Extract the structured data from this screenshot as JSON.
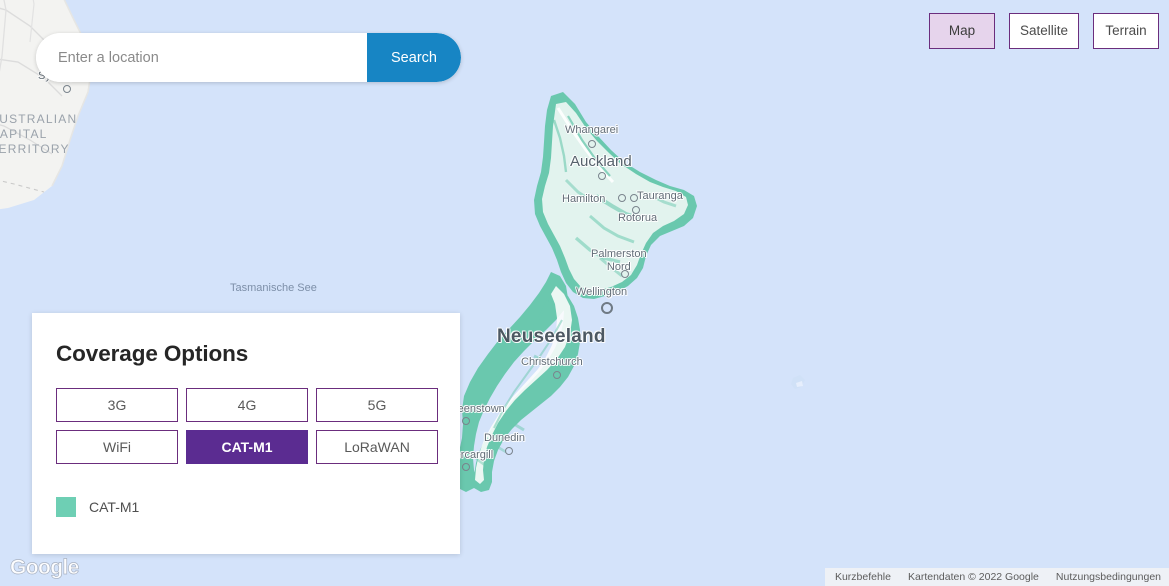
{
  "search": {
    "placeholder": "Enter a location",
    "value": "",
    "button_label": "Search"
  },
  "map_types": [
    {
      "label": "Map",
      "active": true
    },
    {
      "label": "Satellite",
      "active": false
    },
    {
      "label": "Terrain",
      "active": false
    }
  ],
  "coverage_panel": {
    "title": "Coverage Options",
    "options": [
      {
        "label": "3G",
        "selected": false
      },
      {
        "label": "4G",
        "selected": false
      },
      {
        "label": "5G",
        "selected": false
      },
      {
        "label": "WiFi",
        "selected": false
      },
      {
        "label": "CAT-M1",
        "selected": true
      },
      {
        "label": "LoRaWAN",
        "selected": false
      }
    ],
    "legend": {
      "label": "CAT-M1",
      "color": "#6ecfb4"
    }
  },
  "map": {
    "country_label": "Neuseeland",
    "sea_label": "Tasmanische See",
    "region_label": "AUSTRALIAN CAPITAL TERRITORY",
    "cities": [
      {
        "name": "Sydney"
      },
      {
        "name": "Whangarei"
      },
      {
        "name": "Auckland"
      },
      {
        "name": "Hamilton"
      },
      {
        "name": "Tauranga"
      },
      {
        "name": "Rotorua"
      },
      {
        "name": "Palmerston Nord"
      },
      {
        "name": "Wellington"
      },
      {
        "name": "Christchurch"
      },
      {
        "name": "Queenstown"
      },
      {
        "name": "Dunedin"
      },
      {
        "name": "Invercargill"
      }
    ],
    "colors": {
      "ocean": "#d4e3fa",
      "land": "#f4f4f2",
      "coverage": "#6ac8ae"
    }
  },
  "google_logo": "Google",
  "attribution": {
    "shortcuts": "Kurzbefehle",
    "map_data": "Kartendaten © 2022 Google",
    "terms": "Nutzungsbedingungen"
  }
}
